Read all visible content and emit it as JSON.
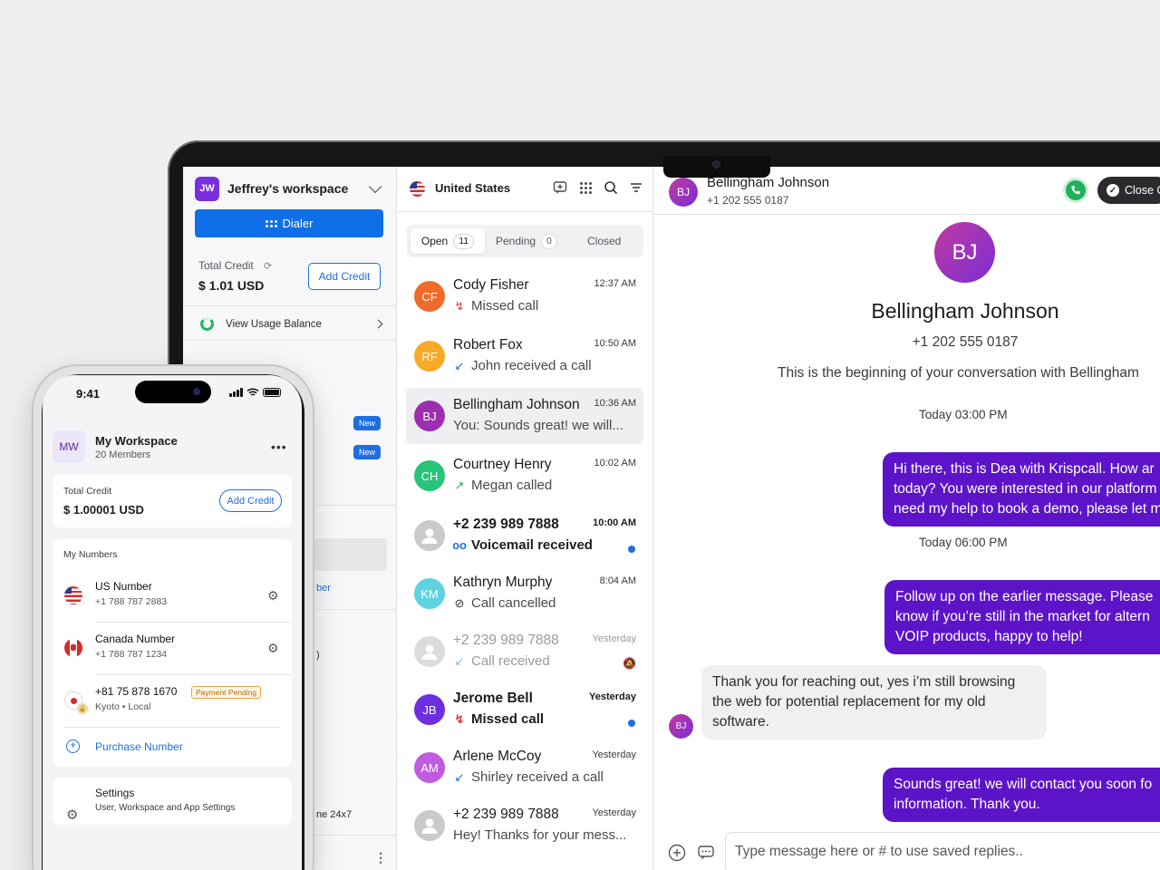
{
  "desktop": {
    "workspace": {
      "initials": "JW",
      "name": "Jeffrey's workspace"
    },
    "dialer_label": "Dialer",
    "credit": {
      "label": "Total Credit",
      "value": "$ 1.01 USD",
      "add_label": "Add Credit"
    },
    "usage_label": "View Usage Balance",
    "sidebar_badges": [
      "New",
      "New"
    ],
    "sidebar_fragments": [
      "ber",
      ")",
      "ne 24x7"
    ],
    "list": {
      "country": "United States",
      "tabs": [
        {
          "label": "Open",
          "count": "11"
        },
        {
          "label": "Pending",
          "count": "0"
        },
        {
          "label": "Closed",
          "count": ""
        }
      ],
      "conversations": [
        {
          "initials": "CF",
          "color": "#f06a2b",
          "name": "Cody Fisher",
          "time": "12:37 AM",
          "icon": "↯",
          "icon_color": "#e23b3b",
          "sub": "Missed call",
          "state": "normal"
        },
        {
          "initials": "RF",
          "color": "#f7a928",
          "name": "Robert Fox",
          "time": "10:50 AM",
          "icon": "↙",
          "icon_color": "#1e6fe0",
          "sub": "John received a call",
          "state": "normal"
        },
        {
          "initials": "BJ",
          "color": "#9b2fb0",
          "name": "Bellingham Johnson",
          "time": "10:36 AM",
          "icon": "",
          "icon_color": "",
          "sub": "You: Sounds great! we will...",
          "state": "selected"
        },
        {
          "initials": "CH",
          "color": "#27c47a",
          "name": "Courtney Henry",
          "time": "10:02 AM",
          "icon": "↗",
          "icon_color": "#1fb25a",
          "sub": "Megan called",
          "state": "normal"
        },
        {
          "initials": "",
          "color": "#c9c9ce",
          "name": "+2 239 989 7888",
          "time": "10:00 AM",
          "icon": "oo",
          "icon_color": "#1e6fe0",
          "sub": "Voicemail received",
          "state": "bold"
        },
        {
          "initials": "KM",
          "color": "#5fd2e0",
          "name": "Kathryn Murphy",
          "time": "8:04 AM",
          "icon": "⊘",
          "icon_color": "#333",
          "sub": "Call cancelled",
          "state": "normal"
        },
        {
          "initials": "",
          "color": "#dcdce0",
          "name": "+2 239 989 7888",
          "time": "Yesterday",
          "icon": "↙",
          "icon_color": "#8fb5ef",
          "sub": "Call received",
          "state": "muted"
        },
        {
          "initials": "JB",
          "color": "#6e2ee0",
          "name": "Jerome Bell",
          "time": "Yesterday",
          "icon": "↯",
          "icon_color": "#e23b3b",
          "sub": "Missed call",
          "state": "bold"
        },
        {
          "initials": "AM",
          "color": "#c15be0",
          "name": "Arlene McCoy",
          "time": "Yesterday",
          "icon": "↙",
          "icon_color": "#1e6fe0",
          "sub": "Shirley received a call",
          "state": "normal"
        },
        {
          "initials": "",
          "color": "#c9c9ce",
          "name": "+2 239 989 7888",
          "time": "Yesterday",
          "icon": "",
          "icon_color": "",
          "sub": "Hey! Thanks for your mess...",
          "state": "normal"
        }
      ]
    },
    "chat": {
      "initials": "BJ",
      "contact_name": "Bellingham Johnson",
      "contact_number": "+1 202 555 0187",
      "close_label": "Close C",
      "intro": "This is the beginning of your conversation with Bellingham",
      "stamp1": "Today 03:00 PM",
      "stamp2": "Today 06:00 PM",
      "msg1": [
        "Hi there, this is Dea with Krispcall. How ar",
        "today? You were interested in our platform",
        "need my help to book a demo, please let m"
      ],
      "msg2": [
        "Follow up on the earlier message. Please",
        "know if you’re still in the market for altern",
        "VOIP products, happy to help!"
      ],
      "msg3": [
        "Thank you for reaching out, yes i’m still browsing",
        "the web for potential replacement for my old",
        "software."
      ],
      "msg4": [
        "Sounds great! we will contact you soon fo",
        "information. Thank you."
      ],
      "composer_placeholder": "Type message here or # to use saved replies.."
    }
  },
  "phone": {
    "time": "9:41",
    "workspace": {
      "initials": "MW",
      "name": "My Workspace",
      "members": "20 Members"
    },
    "credit": {
      "label": "Total Credit",
      "value": "$ 1.00001 USD",
      "add_label": "Add Credit"
    },
    "numbers_label": "My Numbers",
    "numbers": [
      {
        "title": "US Number",
        "sub": "+1 788 787 2883"
      },
      {
        "title": "Canada Number",
        "sub": "+1 788 787 1234"
      },
      {
        "title": "+81 75 878 1670",
        "sub": "Kyoto • Local",
        "badge": "Payment Pending"
      }
    ],
    "purchase_label": "Purchase Number",
    "settings": {
      "title": "Settings",
      "sub": "User, Workspace and App Settings"
    }
  }
}
